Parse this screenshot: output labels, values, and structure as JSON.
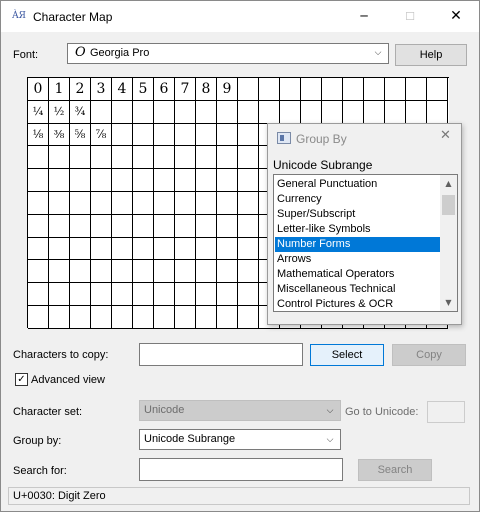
{
  "window": {
    "title": "Character Map",
    "icon": "charmap-app-icon",
    "controls": {
      "minimize": "─",
      "maximize": "☐",
      "close": "✕"
    }
  },
  "font": {
    "label": "Font:",
    "value": "Georgia Pro",
    "glyph": "O",
    "help_label": "Help"
  },
  "grid": {
    "chars": [
      "0",
      "1",
      "2",
      "3",
      "4",
      "5",
      "6",
      "7",
      "8",
      "9",
      "¼",
      "½",
      "¾",
      "⅛",
      "⅜",
      "⅝",
      "⅞"
    ]
  },
  "group_by_popup": {
    "title": "Group By",
    "close": "✕",
    "selected_header": "Unicode Subrange",
    "items": [
      "General Punctuation",
      "Currency",
      "Super/Subscript",
      "Letter-like Symbols",
      "Number Forms",
      "Arrows",
      "Mathematical Operators",
      "Miscellaneous Technical",
      "Control Pictures & OCR"
    ],
    "selected_item": "Number Forms"
  },
  "copy": {
    "label": "Characters to copy:",
    "value": "",
    "select_label": "Select",
    "copy_label": "Copy"
  },
  "advanced": {
    "label": "Advanced view",
    "checked": true,
    "check_glyph": "✓"
  },
  "charset": {
    "label": "Character set:",
    "value": "Unicode",
    "goto_label": "Go to Unicode:",
    "goto_value": ""
  },
  "groupby": {
    "label": "Group by:",
    "value": "Unicode Subrange"
  },
  "search": {
    "label": "Search for:",
    "value": "",
    "button_label": "Search"
  },
  "status": {
    "text": "U+0030: Digit Zero"
  },
  "colors": {
    "selection": "#0078d7",
    "focus_border": "#0078d7"
  }
}
